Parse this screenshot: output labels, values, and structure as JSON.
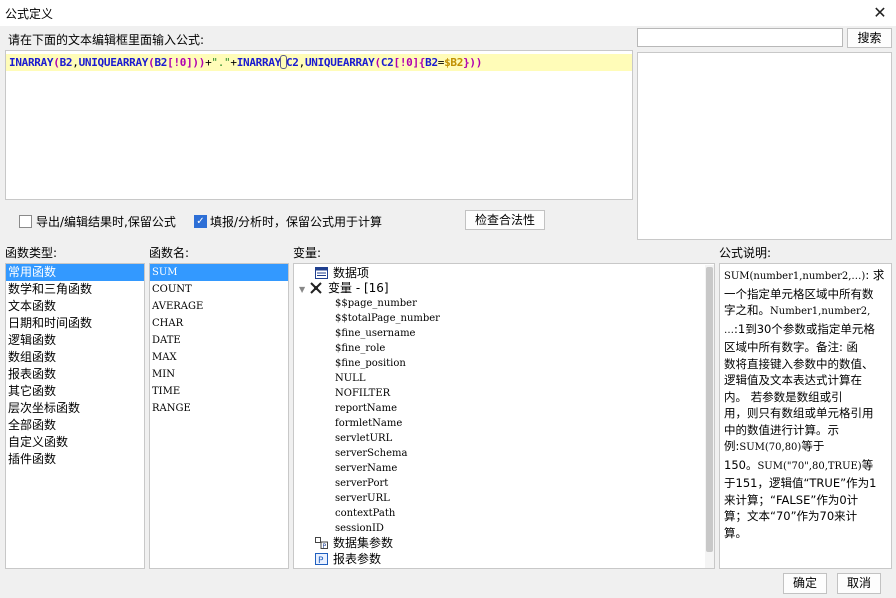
{
  "window": {
    "title": "公式定义",
    "close": "✕"
  },
  "editor": {
    "prompt": "请在下面的文本编辑框里面输入公式:",
    "formula_parts": {
      "p1": "INARRAY",
      "p2": "(",
      "p3": "B2",
      "p4": ",",
      "p5": "UNIQUEARRAY",
      "p6": "(",
      "p7": "B2",
      "p8": "[!0]",
      "p9": "))",
      "p10": "+",
      "p11": "\".\"",
      "p12": "+",
      "p13": "INARRAY",
      "p14": "C2",
      "p15": ",",
      "p16": "UNIQUEARRAY",
      "p17": "(",
      "p18": "C2",
      "p19": "[!0]",
      "p20": "{",
      "p21": "B2",
      "p22": "=",
      "p23": "$B2",
      "p24": "}",
      "p25": "))"
    }
  },
  "search": {
    "value": "",
    "button_label": "搜索"
  },
  "options": {
    "keep_formula_export": {
      "label": "导出/编辑结果时,保留公式",
      "checked": false
    },
    "keep_formula_fill": {
      "label": "填报/分析时，保留公式用于计算",
      "checked": true
    },
    "check_button": "检查合法性"
  },
  "function_types": {
    "header": "函数类型:",
    "items": [
      "常用函数",
      "数学和三角函数",
      "文本函数",
      "日期和时间函数",
      "逻辑函数",
      "数组函数",
      "报表函数",
      "其它函数",
      "层次坐标函数",
      "全部函数",
      "自定义函数",
      "插件函数"
    ],
    "selected": 0
  },
  "function_names": {
    "header": "函数名:",
    "items": [
      "SUM",
      "COUNT",
      "AVERAGE",
      "CHAR",
      "DATE",
      "MAX",
      "MIN",
      "TIME",
      "RANGE"
    ],
    "selected": 0
  },
  "variables": {
    "header": "变量:",
    "data_items": "数据项",
    "variables_node": "变量 - [16]",
    "children": [
      "$$page_number",
      "$$totalPage_number",
      "$fine_username",
      "$fine_role",
      "$fine_position",
      "NULL",
      "NOFILTER",
      "reportName",
      "formletName",
      "servletURL",
      "serverSchema",
      "serverName",
      "serverPort",
      "serverURL",
      "contextPath",
      "sessionID"
    ],
    "dataset_params": "数据集参数",
    "report_params": "报表参数"
  },
  "description": {
    "header": "公式说明:",
    "lines": [
      {
        "t": "SUM(number1,number2,…)",
        "m": true
      },
      {
        "t": ": 求"
      },
      {
        "br": true
      },
      {
        "t": "一个指定单元格区域中所有数"
      },
      {
        "br": true
      },
      {
        "t": "字之和。"
      },
      {
        "t": "Number1,number2,",
        "m": true
      },
      {
        "br": true
      },
      {
        "t": "…",
        "m": true
      },
      {
        "t": ":1到30个参数或指定单元格"
      },
      {
        "br": true
      },
      {
        "t": "区域中所有数字。备注:    函"
      },
      {
        "br": true
      },
      {
        "t": "数将直接键入参数中的数值、"
      },
      {
        "br": true
      },
      {
        "t": "逻辑值及文本表达式计算在"
      },
      {
        "br": true
      },
      {
        "t": "内。     若参数是数组或引"
      },
      {
        "br": true
      },
      {
        "t": "用，则只有数组或单元格引用"
      },
      {
        "br": true
      },
      {
        "t": "中的数值进行计算。示"
      },
      {
        "br": true
      },
      {
        "t": "例:"
      },
      {
        "t": "SUM(70,80)",
        "m": true
      },
      {
        "t": "等于"
      },
      {
        "br": true
      },
      {
        "t": "150。"
      },
      {
        "t": "SUM(\"70\",80,TRUE)",
        "m": true
      },
      {
        "t": "等"
      },
      {
        "br": true
      },
      {
        "t": "于151，逻辑值“TRUE”作为1"
      },
      {
        "br": true
      },
      {
        "t": "来计算；“FALSE”作为0计"
      },
      {
        "br": true
      },
      {
        "t": "算；文本“70”作为70来计"
      },
      {
        "br": true
      },
      {
        "t": "算。"
      }
    ]
  },
  "footer": {
    "ok": "确定",
    "cancel": "取消"
  }
}
